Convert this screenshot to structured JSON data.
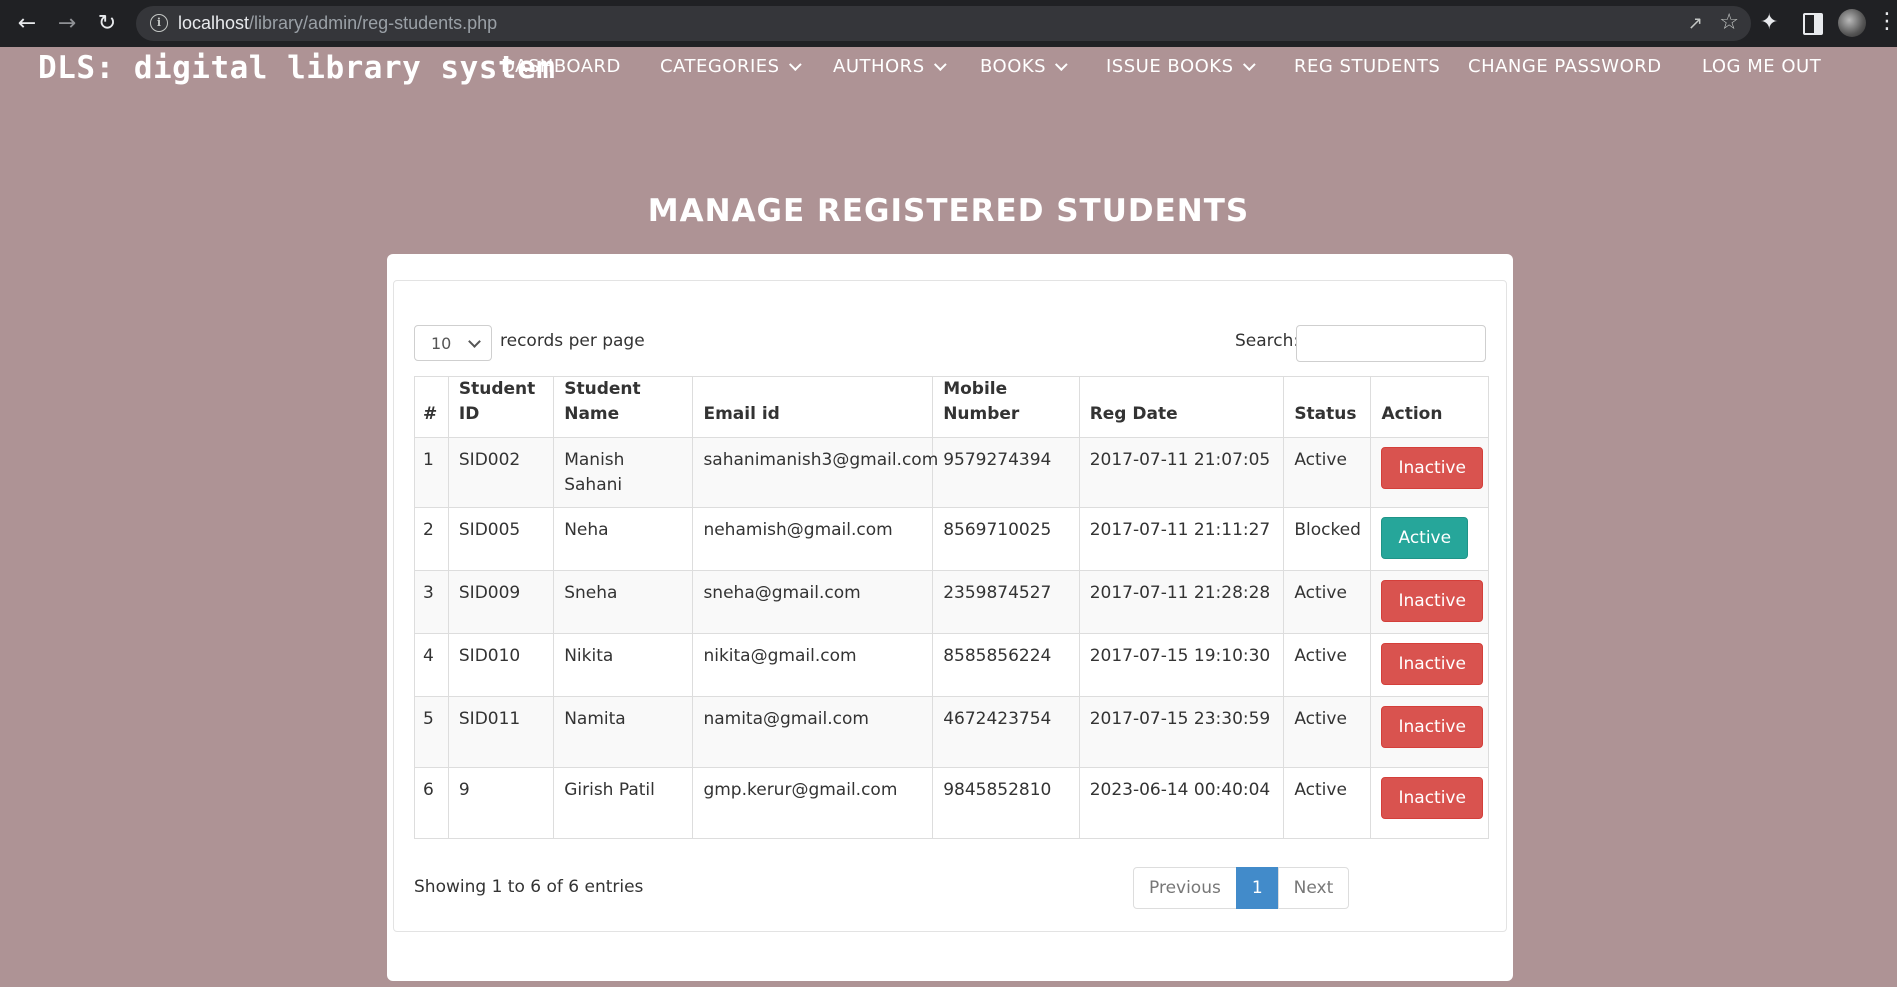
{
  "browser": {
    "url_host": "localhost",
    "url_path": "/library/admin/reg-students.php"
  },
  "header": {
    "brand": "DLS: digital library system",
    "nav": [
      {
        "label": "DASHBOARD",
        "dropdown": false
      },
      {
        "label": "CATEGORIES",
        "dropdown": true
      },
      {
        "label": "AUTHORS",
        "dropdown": true
      },
      {
        "label": "BOOKS",
        "dropdown": true
      },
      {
        "label": "ISSUE BOOKS",
        "dropdown": true
      },
      {
        "label": "REG STUDENTS",
        "dropdown": false
      },
      {
        "label": "CHANGE PASSWORD",
        "dropdown": false
      },
      {
        "label": "LOG ME OUT",
        "dropdown": false
      }
    ]
  },
  "page_title": "MANAGE REGISTERED STUDENTS",
  "table_controls": {
    "length_value": "10",
    "length_label": "records per page",
    "search_label": "Search:",
    "search_value": ""
  },
  "table": {
    "columns": [
      "#",
      "Student ID",
      "Student Name",
      "Email id",
      "Mobile Number",
      "Reg Date",
      "Status",
      "Action"
    ],
    "rows": [
      {
        "n": "1",
        "id": "SID002",
        "name": "Manish Sahani",
        "email": "sahanimanish3@gmail.com",
        "mobile": "9579274394",
        "date": "2017-07-11 21:07:05",
        "status": "Active",
        "action": "Inactive",
        "action_type": "danger"
      },
      {
        "n": "2",
        "id": "SID005",
        "name": "Neha",
        "email": "nehamish@gmail.com",
        "mobile": "8569710025",
        "date": "2017-07-11 21:11:27",
        "status": "Blocked",
        "action": "Active",
        "action_type": "success"
      },
      {
        "n": "3",
        "id": "SID009",
        "name": "Sneha",
        "email": "sneha@gmail.com",
        "mobile": "2359874527",
        "date": "2017-07-11 21:28:28",
        "status": "Active",
        "action": "Inactive",
        "action_type": "danger"
      },
      {
        "n": "4",
        "id": "SID010",
        "name": "Nikita",
        "email": "nikita@gmail.com",
        "mobile": "8585856224",
        "date": "2017-07-15 19:10:30",
        "status": "Active",
        "action": "Inactive",
        "action_type": "danger"
      },
      {
        "n": "5",
        "id": "SID011",
        "name": "Namita",
        "email": "namita@gmail.com",
        "mobile": "4672423754",
        "date": "2017-07-15 23:30:59",
        "status": "Active",
        "action": "Inactive",
        "action_type": "danger"
      },
      {
        "n": "6",
        "id": "9",
        "name": "Girish Patil",
        "email": "gmp.kerur@gmail.com",
        "mobile": "9845852810",
        "date": "2023-06-14 00:40:04",
        "status": "Active",
        "action": "Inactive",
        "action_type": "danger"
      }
    ]
  },
  "footer": {
    "info": "Showing 1 to 6 of 6 entries",
    "previous": "Previous",
    "page": "1",
    "next": "Next"
  }
}
